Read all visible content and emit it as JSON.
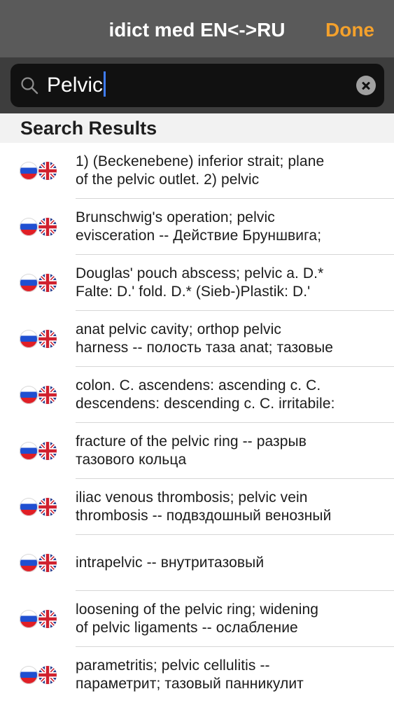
{
  "nav": {
    "title": "idict med EN<->RU",
    "done_label": "Done"
  },
  "search": {
    "value": "Pelvic"
  },
  "section_header": "Search Results",
  "icons": {
    "search": "search-icon",
    "clear": "clear-icon",
    "flag_ru": "russia-flag-icon",
    "flag_gb": "uk-flag-icon"
  },
  "colors": {
    "nav_bg": "#5a5a5a",
    "accent": "#f4a12c",
    "caret": "#3f7cf6"
  },
  "results": [
    {
      "text": "1) (Beckenebene) inferior strait; plane\nof the pelvic outlet. 2) pelvic"
    },
    {
      "text": "Brunschwig's operation; pelvic\nevisceration -- Действие Бруншвига;"
    },
    {
      "text": "Douglas' pouch abscess; pelvic a. D.*\nFalte: D.' fold. D.* (Sieb-)Plastik: D.'"
    },
    {
      "text": "anat pelvic cavity; orthop pelvic\nharness -- полость таза anat; тазовые"
    },
    {
      "text": "colon. C. ascendens: ascending c. C.\ndescendens: descending c. C. irritabile:"
    },
    {
      "text": "fracture of the pelvic ring -- разрыв\nтазового кольца"
    },
    {
      "text": "iliac venous thrombosis; pelvic vein\nthrombosis -- подвздошный венозный"
    },
    {
      "text": "intrapelvic -- внутритазовый"
    },
    {
      "text": "loosening of the pelvic ring; widening\nof pelvic ligaments -- ослабление"
    },
    {
      "text": "parametritis; pelvic cellulitis --\nпараметрит; тазовый панникулит"
    }
  ]
}
